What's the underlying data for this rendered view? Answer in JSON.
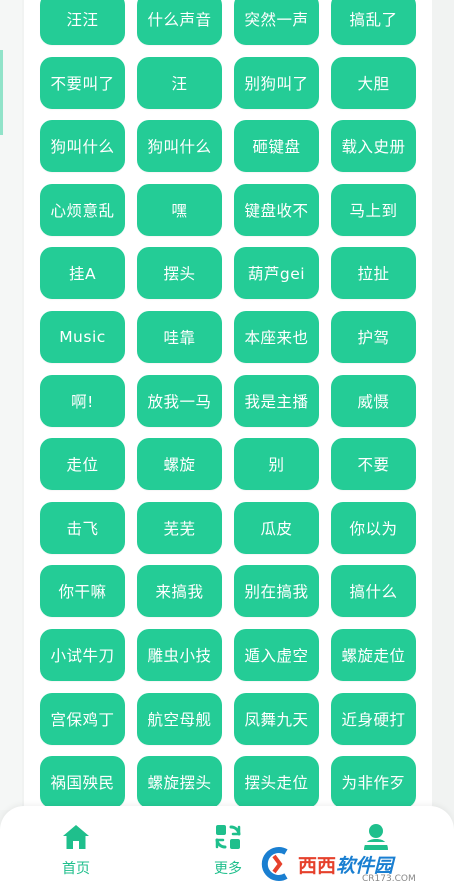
{
  "colors": {
    "accent": "#24cc96",
    "tab_active": "#1fbf8c",
    "background": "#f1f3f2"
  },
  "sound_buttons": [
    "汪汪",
    "什么声音",
    "突然一声",
    "搞乱了",
    "不要叫了",
    "汪",
    "别狗叫了",
    "大胆",
    "狗叫什么",
    "狗叫什么",
    "砸键盘",
    "载入史册",
    "心烦意乱",
    "嘿",
    "键盘收不",
    "马上到",
    "挂A",
    "摆头",
    "葫芦gei",
    "拉扯",
    "Music",
    "哇靠",
    "本座来也",
    "护驾",
    "啊!",
    "放我一马",
    "我是主播",
    "威慑",
    "走位",
    "螺旋",
    "别",
    "不要",
    "击飞",
    "芜芜",
    "瓜皮",
    "你以为",
    "你干嘛",
    "来搞我",
    "别在搞我",
    "搞什么",
    "小试牛刀",
    "雕虫小技",
    "遁入虚空",
    "螺旋走位",
    "宫保鸡丁",
    "航空母舰",
    "凤舞九天",
    "近身硬打",
    "祸国殃民",
    "螺旋摆头",
    "摆头走位",
    "为非作歹"
  ],
  "tabbar": {
    "home": {
      "label": "首页",
      "icon": "home-icon"
    },
    "more": {
      "label": "更多",
      "icon": "grid-refresh-icon"
    },
    "profile": {
      "label": "",
      "icon": "user-icon"
    }
  },
  "watermark": {
    "brand_a": "西西",
    "brand_b": "软件园",
    "domain": "CR173.COM"
  }
}
